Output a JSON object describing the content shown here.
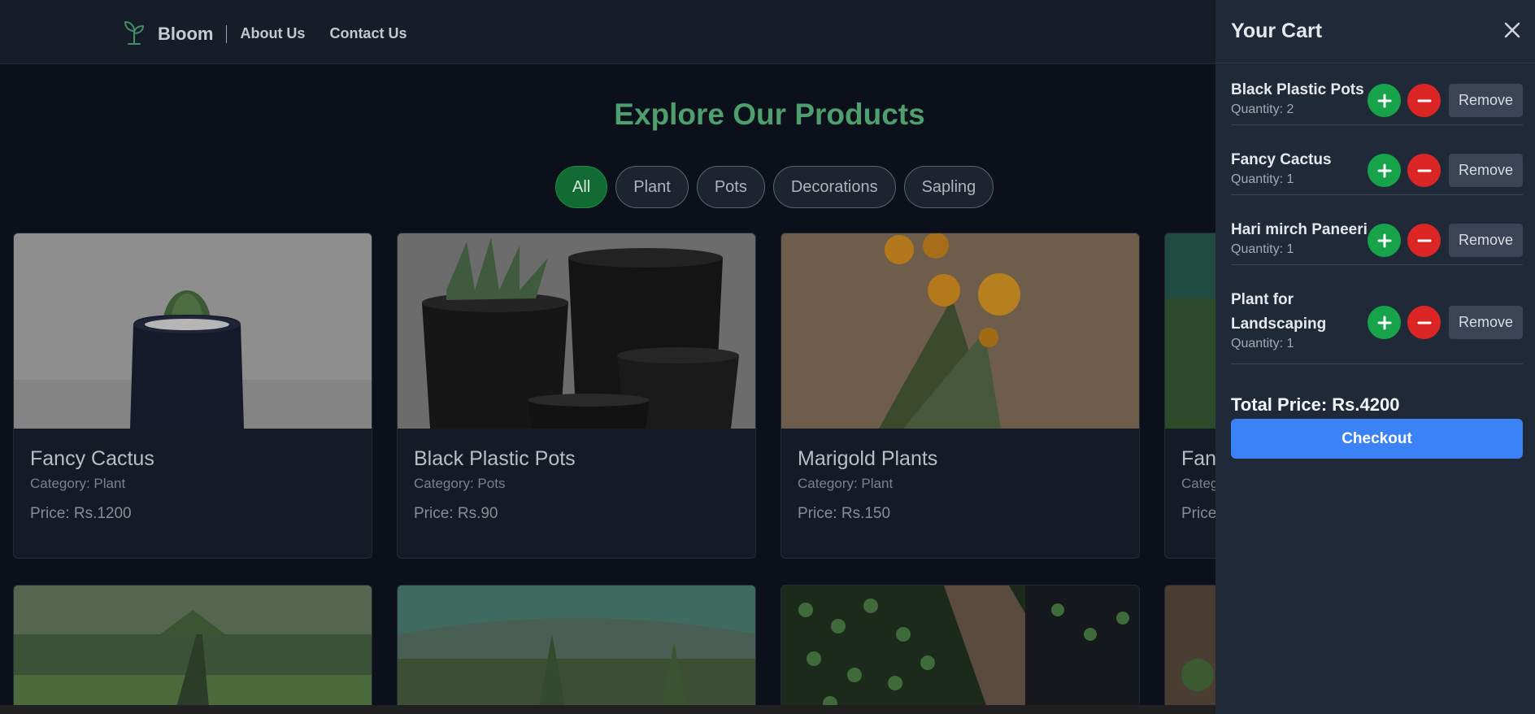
{
  "nav": {
    "brand": "Bloom",
    "links": [
      "About Us",
      "Contact Us"
    ]
  },
  "main": {
    "title": "Explore Our Products",
    "filters": [
      "All",
      "Plant",
      "Pots",
      "Decorations",
      "Sapling"
    ],
    "active_filter": "All",
    "products": [
      {
        "name": "Fancy Cactus",
        "category": "Category: Plant",
        "price": "Price: Rs.1200"
      },
      {
        "name": "Black Plastic Pots",
        "category": "Category: Pots",
        "price": "Price: Rs.90"
      },
      {
        "name": "Marigold Plants",
        "category": "Category: Plant",
        "price": "Price: Rs.150"
      },
      {
        "name": "Fanc",
        "category": "Categ",
        "price": "Price"
      }
    ]
  },
  "cart": {
    "title": "Your Cart",
    "items": [
      {
        "name": "Black Plastic Pots",
        "quantity": "Quantity: 2"
      },
      {
        "name": "Fancy Cactus",
        "quantity": "Quantity: 1"
      },
      {
        "name": "Hari mirch Paneeri",
        "quantity": "Quantity: 1"
      },
      {
        "name": "Plant for Landscaping",
        "quantity": "Quantity: 1"
      }
    ],
    "remove_label": "Remove",
    "total": "Total Price: Rs.4200",
    "checkout_label": "Checkout"
  },
  "colors": {
    "accent_green": "#4e9e6e",
    "checkout_blue": "#3b82f6",
    "plus_green": "#16a34a",
    "minus_red": "#dc2626"
  }
}
